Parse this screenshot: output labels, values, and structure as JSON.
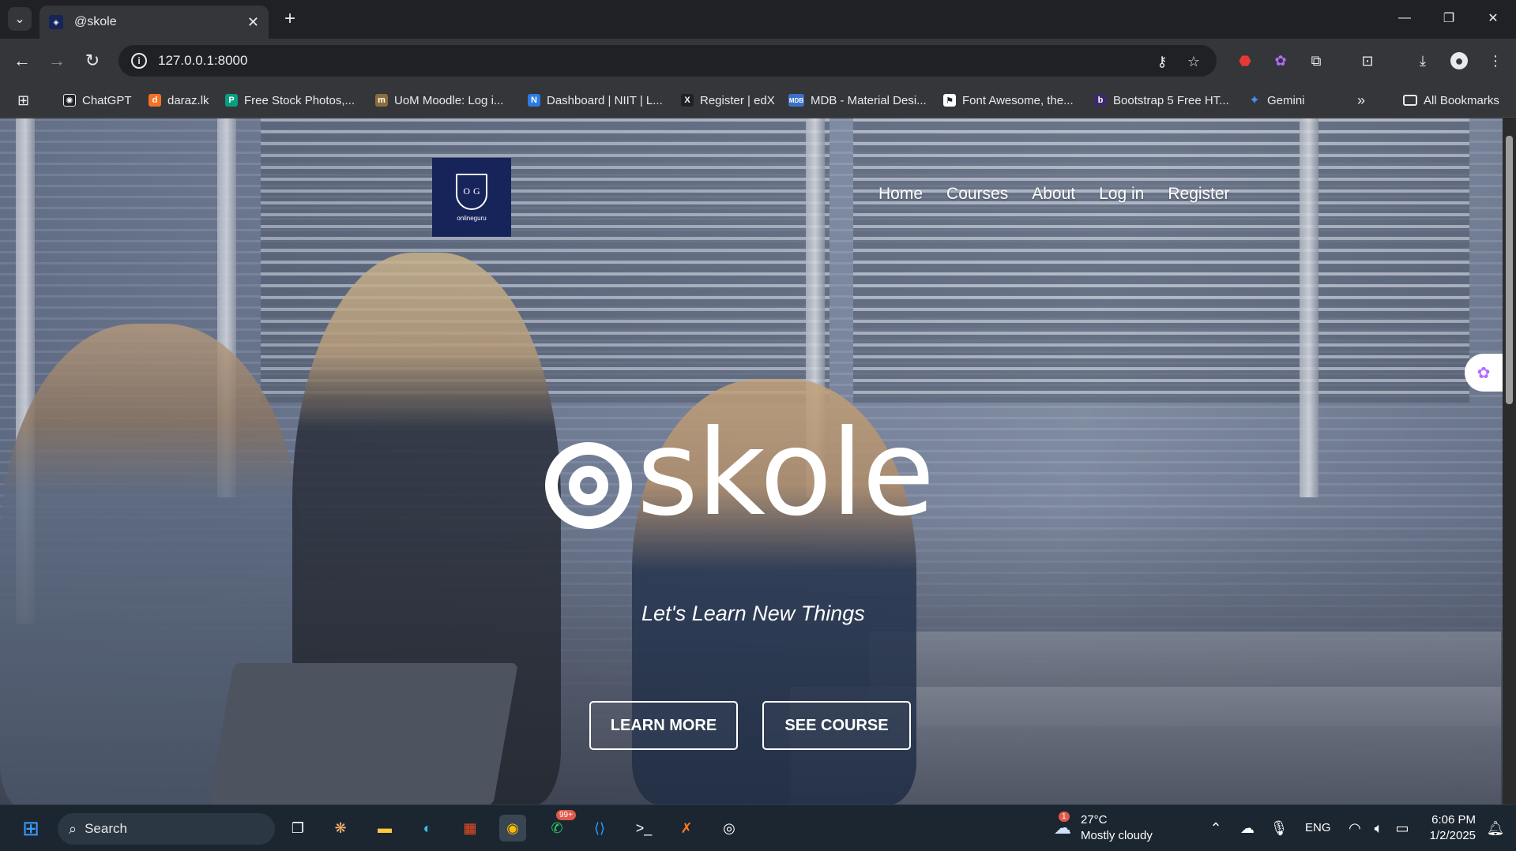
{
  "browser": {
    "tab_title": "@skole",
    "url": "127.0.0.1:8000",
    "bookmarks": [
      {
        "label": "ChatGPT",
        "icon": "chatgpt-icon",
        "color": "#202124"
      },
      {
        "label": "daraz.lk",
        "icon": "daraz-icon",
        "color": "#f57224"
      },
      {
        "label": "Free Stock Photos,...",
        "icon": "pexels-icon",
        "color": "#05a081"
      },
      {
        "label": "UoM Moodle: Log i...",
        "icon": "moodle-icon",
        "color": "#8a6d3b"
      },
      {
        "label": "Dashboard | NIIT | L...",
        "icon": "niit-icon",
        "color": "#2d7be5"
      },
      {
        "label": "Register | edX",
        "icon": "edx-icon",
        "color": "#202124"
      },
      {
        "label": "MDB - Material Desi...",
        "icon": "mdb-icon",
        "color": "#3b71ca"
      },
      {
        "label": "Font Awesome, the...",
        "icon": "fontawesome-icon",
        "color": "#202124"
      },
      {
        "label": "Bootstrap 5 Free HT...",
        "icon": "bootstrap-icon",
        "color": "#3b2a68"
      },
      {
        "label": "Gemini",
        "icon": "gemini-icon",
        "color": "#4b8df8"
      }
    ],
    "all_bookmarks_label": "All Bookmarks"
  },
  "site": {
    "logo_text": "onlineguru",
    "logo_letters": [
      "O",
      "G"
    ],
    "nav": [
      "Home",
      "Courses",
      "About",
      "Log in",
      "Register"
    ],
    "brand": "skole",
    "tagline": "Let's Learn New Things",
    "buttons": {
      "learn_more": "LEARN MORE",
      "see_course": "SEE COURSE"
    }
  },
  "taskbar": {
    "search_placeholder": "Search",
    "whatsapp_badge": "99+",
    "weather_badge": "1",
    "temperature": "27°C",
    "weather": "Mostly cloudy",
    "language": "ENG",
    "time": "6:06 PM",
    "date": "1/2/2025"
  },
  "colors": {
    "brand_navy": "#16245a",
    "chrome_dark": "#202124",
    "chrome_mid": "#35363a",
    "taskbar": "#1c2631"
  }
}
